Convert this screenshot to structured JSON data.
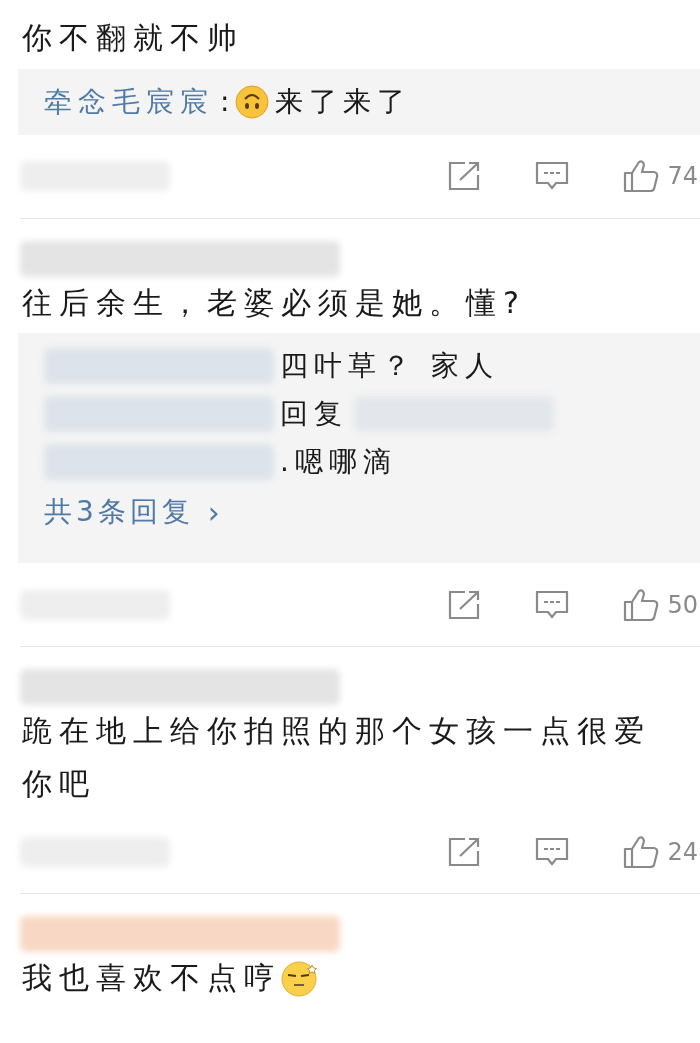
{
  "comments": [
    {
      "text": "你不翻就不帅",
      "reply_box": {
        "lines": [
          {
            "author": "牵念毛宸宸",
            "separator": ":",
            "emoji": {
              "kind": "upside_down"
            },
            "text": "来了来了",
            "blur_before": false,
            "blur_after": false
          }
        ]
      },
      "footer_blurred": true,
      "likes": "74"
    },
    {
      "name_patch": {
        "color": "#e4e4e4"
      },
      "text": "往后余生，老婆必须是她。懂?",
      "reply_box": {
        "lines": [
          {
            "text": "四叶草？ 家人",
            "blur_before": true,
            "blur_after": false
          },
          {
            "text": "回复",
            "blur_before": true,
            "blur_after": true
          },
          {
            "text": ".嗯哪滴",
            "blur_before": true,
            "blur_after": false
          }
        ],
        "more": "共3条回复",
        "chevron": "›"
      },
      "footer_blurred": true,
      "likes": "50"
    },
    {
      "name_patch": {
        "color": "#e4e4e4"
      },
      "text": "跪在地上给你拍照的那个女孩一点很爱你吧",
      "footer_blurred": true,
      "likes": "24"
    },
    {
      "name_patch": {
        "color": "#f8d8c4"
      },
      "text": "我也喜欢不点哼",
      "emoji": {
        "kind": "squint"
      }
    }
  ]
}
